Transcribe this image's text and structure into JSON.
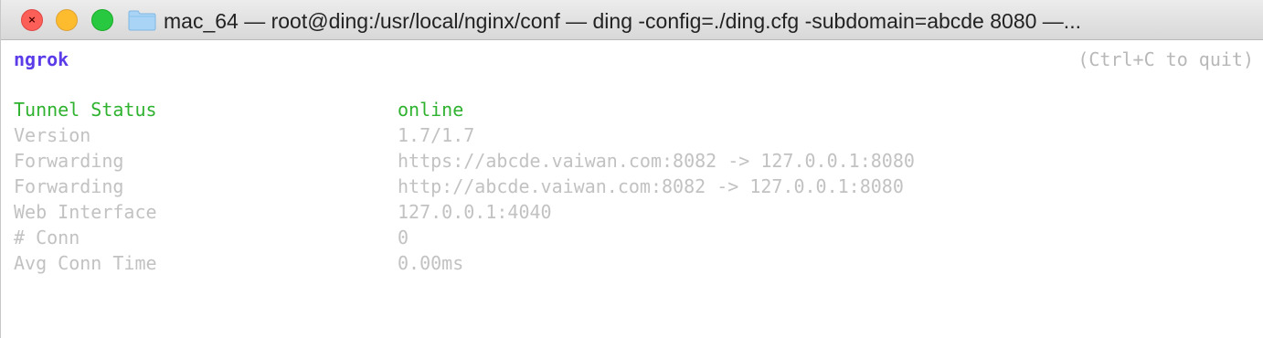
{
  "window": {
    "title": "mac_64 — root@ding:/usr/local/nginx/conf — ding -config=./ding.cfg -subdomain=abcde 8080 —..."
  },
  "colors": {
    "brand": "#5b3ce8",
    "online": "#2fb22f",
    "dim": "#c2c2c2"
  },
  "terminal": {
    "brand": "ngrok",
    "quit_hint": "(Ctrl+C to quit)",
    "rows": [
      {
        "label": "Tunnel Status",
        "value": "online"
      },
      {
        "label": "Version",
        "value": "1.7/1.7"
      },
      {
        "label": "Forwarding",
        "value": "https://abcde.vaiwan.com:8082 -> 127.0.0.1:8080"
      },
      {
        "label": "Forwarding",
        "value": "http://abcde.vaiwan.com:8082 -> 127.0.0.1:8080"
      },
      {
        "label": "Web Interface",
        "value": "127.0.0.1:4040"
      },
      {
        "label": "# Conn",
        "value": "0"
      },
      {
        "label": "Avg Conn Time",
        "value": "0.00ms"
      }
    ]
  }
}
